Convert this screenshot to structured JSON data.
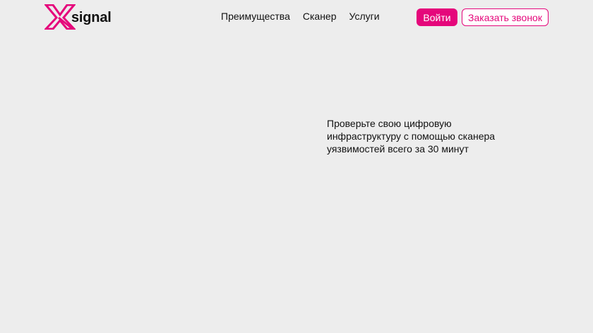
{
  "brand": {
    "name": "signal",
    "logo_icon": "x-mark-icon",
    "accent_color": "#e5077b"
  },
  "nav": {
    "items": [
      {
        "label": "Преимущества"
      },
      {
        "label": "Сканер"
      },
      {
        "label": "Услуги"
      }
    ]
  },
  "actions": {
    "login_label": "Войти",
    "call_label": "Заказать звонок"
  },
  "hero": {
    "description": "Проверьте свою цифровую инфраструктуру с помощью сканера уязвимостей всего за 30 минут"
  }
}
